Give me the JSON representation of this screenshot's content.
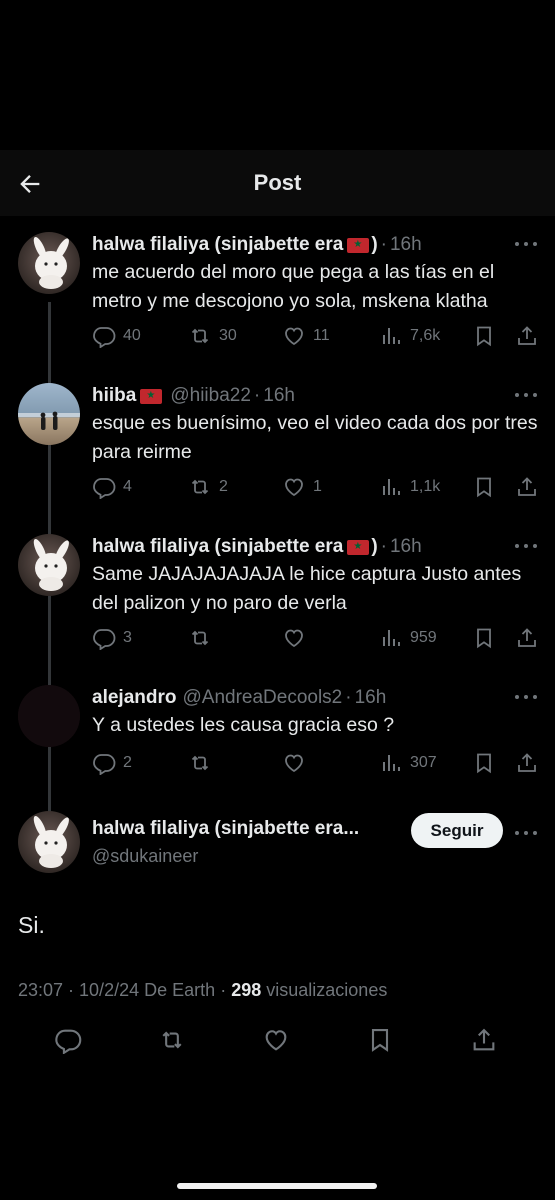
{
  "header": {
    "title": "Post"
  },
  "replies": [
    {
      "name": "halwa filaliya (sinjabette era",
      "name_suffix": ")",
      "handle": "",
      "time": "16h",
      "text": "me acuerdo del moro que pega a las tías en el metro y me descojono yo sola, mskena klatha",
      "replies": "40",
      "retweets": "30",
      "likes": "11",
      "views": "7,6k"
    },
    {
      "name": "hiiba",
      "name_suffix": "",
      "handle": "@hiiba22",
      "time": "16h",
      "text": "esque es buenísimo, veo el video cada dos por tres para reirme",
      "replies": "4",
      "retweets": "2",
      "likes": "1",
      "views": "1,1k"
    },
    {
      "name": "halwa filaliya (sinjabette era",
      "name_suffix": ")",
      "handle": "",
      "time": "16h",
      "text": "Same JAJAJAJAJAJA le hice captura Justo antes del palizon y no paro de verla",
      "replies": "3",
      "retweets": "",
      "likes": "",
      "views": "959"
    },
    {
      "name": "alejandro",
      "name_suffix": "",
      "handle": "@AndreaDecools2",
      "time": "16h",
      "text": "Y a ustedes les causa gracia eso ?",
      "replies": "2",
      "retweets": "",
      "likes": "",
      "views": "307"
    }
  ],
  "main_post": {
    "name": "halwa filaliya (sinjabette era...",
    "handle": "@sdukaineer",
    "follow_label": "Seguir",
    "text": "Si.",
    "timestamp": "23:07 · 10/2/24",
    "source": "De Earth",
    "views_count": "298",
    "views_label": "visualizaciones"
  },
  "separator": "·",
  "colors": {
    "background": "#000000",
    "secondary_text": "#71767b",
    "flag": "#c1272d"
  },
  "icons": [
    "back-arrow-icon",
    "reply-icon",
    "retweet-icon",
    "like-icon",
    "views-icon",
    "bookmark-icon",
    "share-icon",
    "more-icon",
    "flag-icon"
  ]
}
